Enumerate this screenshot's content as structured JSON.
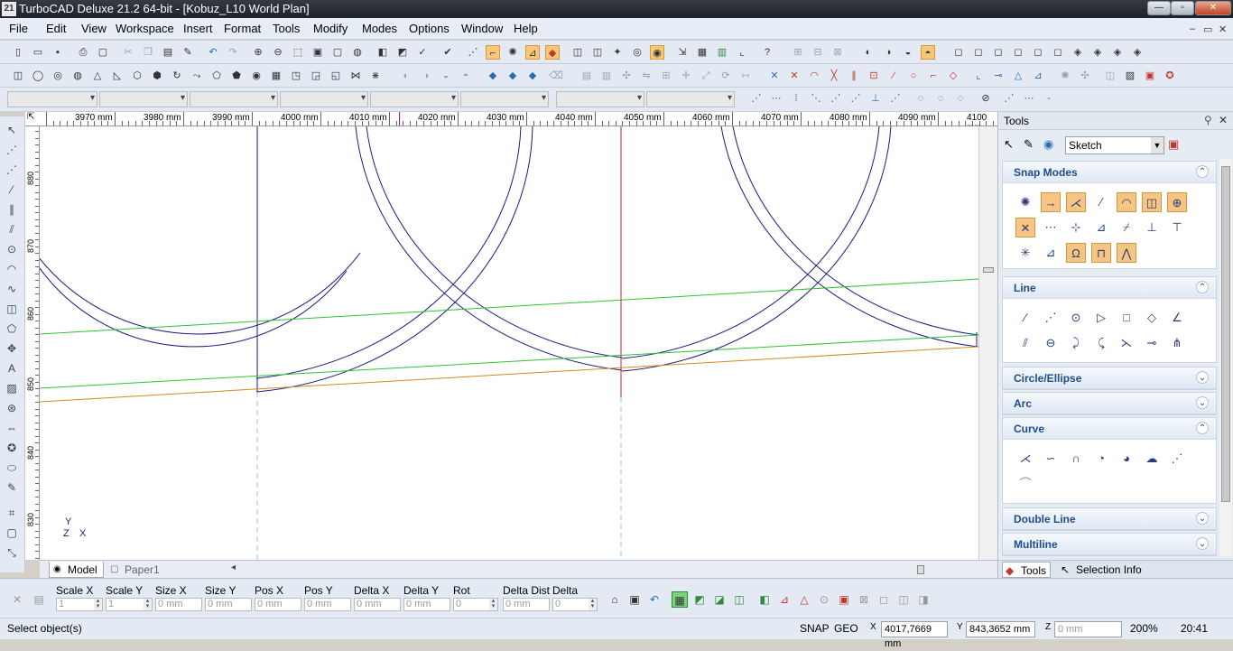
{
  "window": {
    "icon_text": "21",
    "title": "TurboCAD Deluxe 21.2 64-bit - [Kobuz_L10 World Plan]",
    "min": "—",
    "max": "▫",
    "close": "✕"
  },
  "menu": [
    "File",
    "Edit",
    "View",
    "Workspace",
    "Insert",
    "Format",
    "Tools",
    "Modify",
    "Modes",
    "Options",
    "Window",
    "Help"
  ],
  "mdi": {
    "min": "–",
    "restore": "▭",
    "close": "✕"
  },
  "ruler": {
    "h_labels": [
      "3970 mm",
      "3980 mm",
      "3990 mm",
      "4000 mm",
      "4010 mm",
      "4020 mm",
      "4030 mm",
      "4040 mm",
      "4050 mm",
      "4060 mm",
      "4070 mm",
      "4080 mm",
      "4090 mm",
      "4100 mm"
    ],
    "v_labels": [
      "880",
      "870",
      "860",
      "850",
      "840",
      "830"
    ]
  },
  "axis": {
    "y": "Y",
    "z": "Z",
    "x": "X"
  },
  "tabs": {
    "model": "Model",
    "paper": "Paper1"
  },
  "panel": {
    "title": "Tools",
    "mode": "Sketch",
    "sections": {
      "snap": "Snap Modes",
      "line": "Line",
      "circle": "Circle/Ellipse",
      "arc": "Arc",
      "curve": "Curve",
      "double": "Double Line",
      "multi": "Multiline"
    },
    "tabs": {
      "tools": "Tools",
      "selinfo": "Selection Info"
    }
  },
  "coord": {
    "fields": [
      {
        "label": "Scale X",
        "value": "1"
      },
      {
        "label": "Scale Y",
        "value": "1"
      },
      {
        "label": "Size X",
        "value": "0 mm"
      },
      {
        "label": "Size Y",
        "value": "0 mm"
      },
      {
        "label": "Pos X",
        "value": "0 mm"
      },
      {
        "label": "Pos Y",
        "value": "0 mm"
      },
      {
        "label": "Delta X",
        "value": "0 mm"
      },
      {
        "label": "Delta Y",
        "value": "0 mm"
      },
      {
        "label": "Rot",
        "value": "0"
      },
      {
        "label": "Delta Dist",
        "value": "0 mm"
      },
      {
        "label": "Delta Ang",
        "value": "0"
      }
    ]
  },
  "status": {
    "prompt": "Select object(s)",
    "snap": "SNAP",
    "geo": "GEO",
    "x": "4017,7669 mm",
    "y": "843,3652 mm",
    "z": "0 mm",
    "zoom": "200%",
    "time": "20:41"
  }
}
